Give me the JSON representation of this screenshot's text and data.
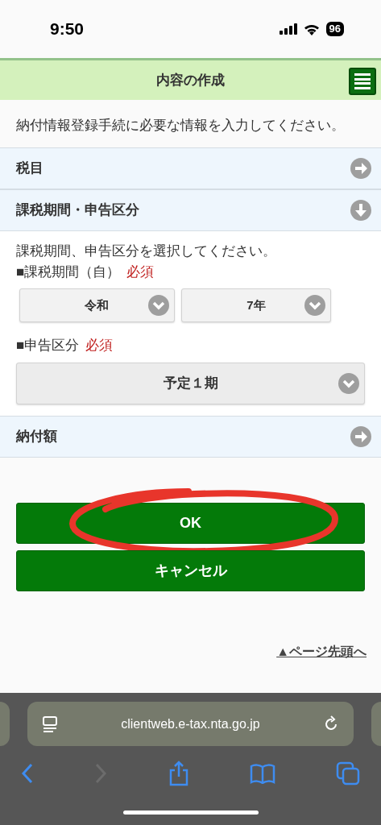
{
  "status_bar": {
    "time": "9:50",
    "battery": "96"
  },
  "header": {
    "title": "内容の作成"
  },
  "intro": "納付情報登録手続に必要な情報を入力してください。",
  "sections": [
    {
      "title": "税目",
      "expanded": false
    },
    {
      "title": "課税期間・申告区分",
      "expanded": true,
      "instruction": "課税期間、申告区分を選択してください。",
      "fields": [
        {
          "label": "■課税期間（自）",
          "required": "必須",
          "selects": [
            "令和",
            "7年"
          ]
        },
        {
          "label": "■申告区分",
          "required": "必須",
          "selects": [
            "予定１期"
          ]
        }
      ]
    },
    {
      "title": "納付額",
      "expanded": false
    }
  ],
  "buttons": [
    {
      "label": "OK",
      "annotated": true
    },
    {
      "label": "キャンセル",
      "annotated": false
    }
  ],
  "annotation": {
    "color": "#e8352b"
  },
  "top_link": "▲ページ先頭へ",
  "browser": {
    "url": "clientweb.e-tax.nta.go.jp",
    "back_disabled": false,
    "forward_disabled": true
  }
}
